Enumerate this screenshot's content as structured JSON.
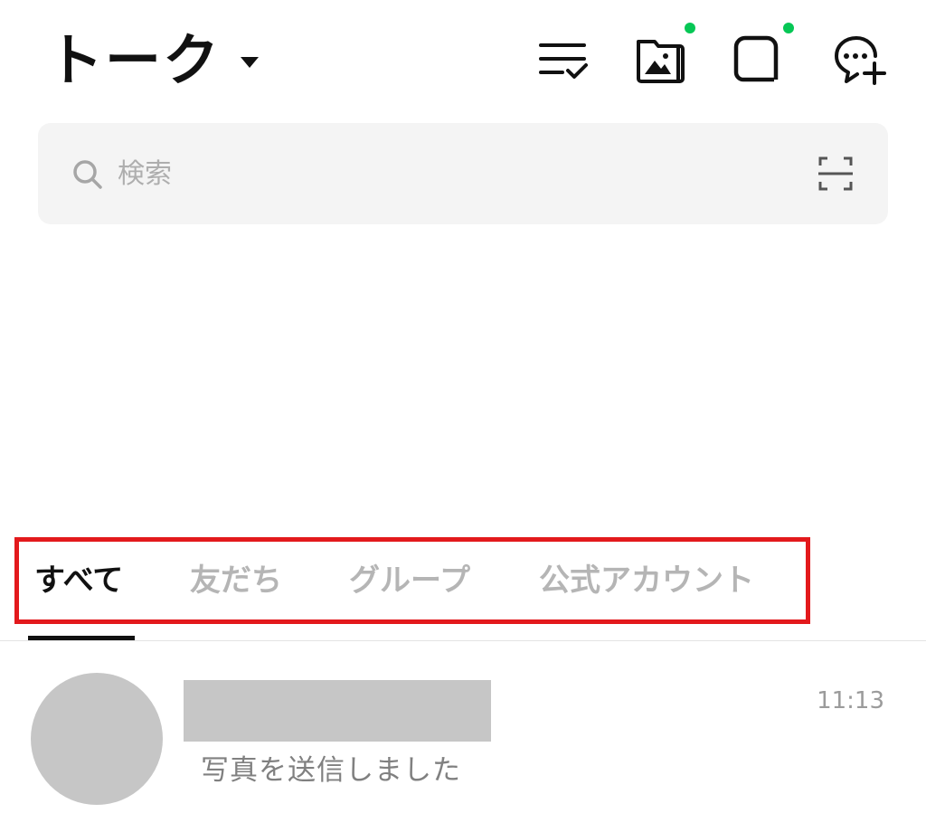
{
  "header": {
    "title": "トーク",
    "icons": [
      {
        "name": "edit-list-icon",
        "badge": false
      },
      {
        "name": "photo-album-icon",
        "badge": true
      },
      {
        "name": "square-chat-icon",
        "badge": true
      },
      {
        "name": "new-chat-icon",
        "badge": false
      }
    ],
    "badge_color": "#06c755"
  },
  "search": {
    "placeholder": "検索",
    "scan_icon": "qr-scan-icon"
  },
  "tabs": {
    "items": [
      {
        "label": "すべて",
        "active": true
      },
      {
        "label": "友だち",
        "active": false
      },
      {
        "label": "グループ",
        "active": false
      },
      {
        "label": "公式アカウント",
        "active": false
      }
    ],
    "highlight_color": "#e3191c"
  },
  "chat_list": [
    {
      "name": "",
      "preview": "写真を送信しました",
      "time": "11:13"
    }
  ]
}
